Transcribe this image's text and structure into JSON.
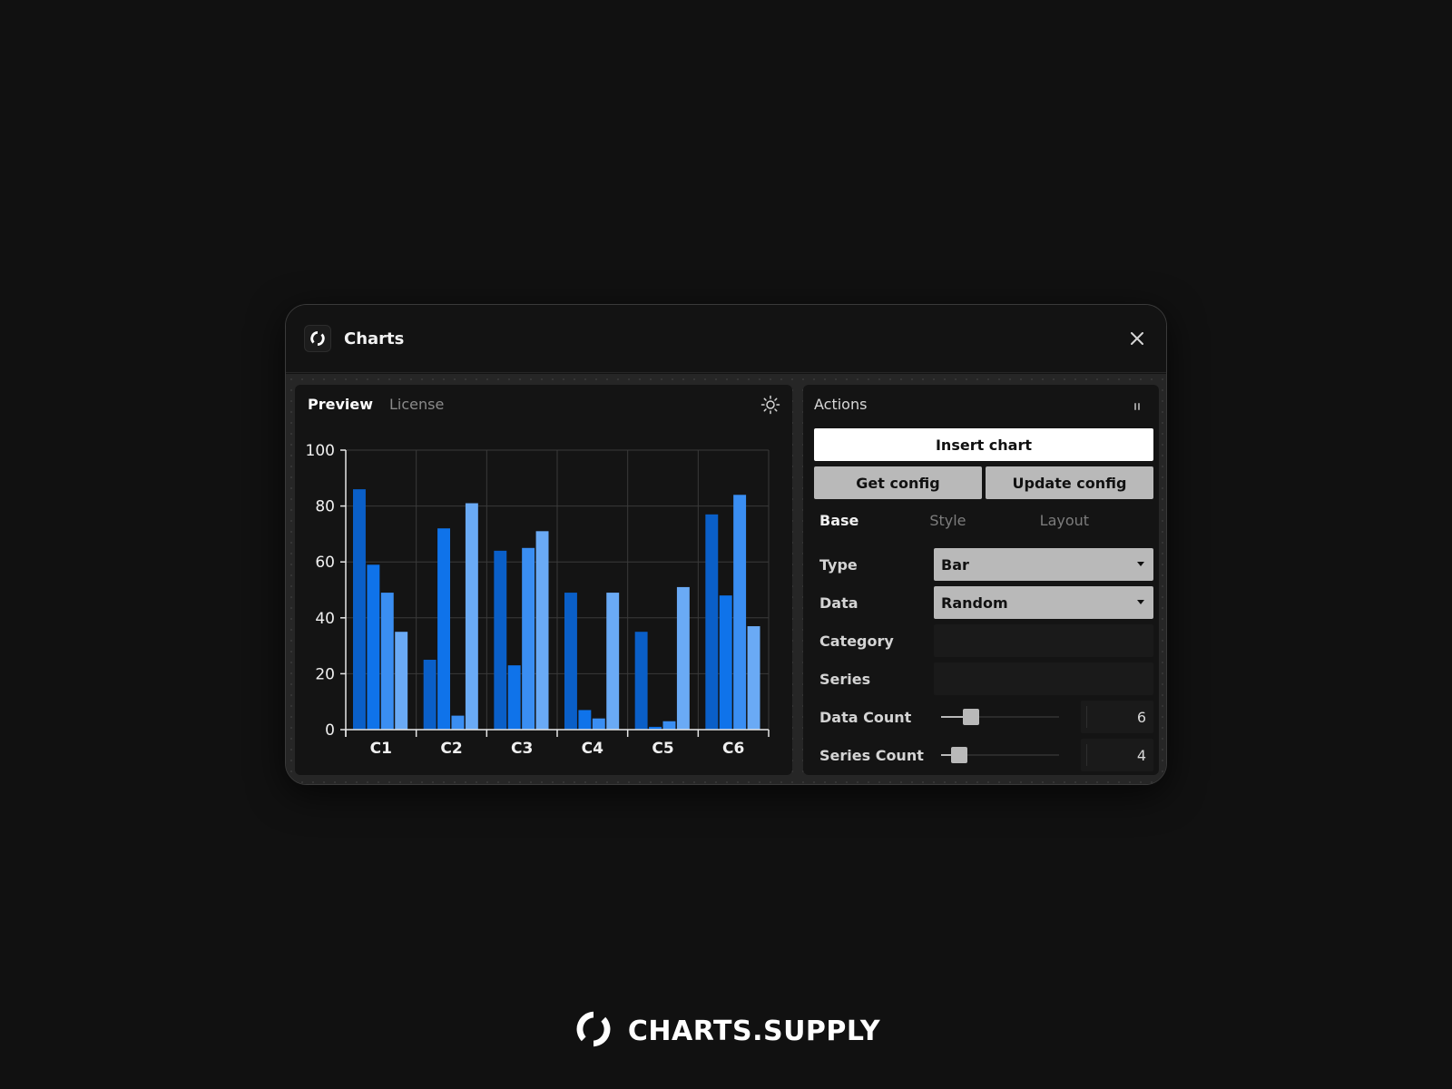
{
  "window": {
    "title": "Charts",
    "app_icon": "charts-supply-logo",
    "close_icon": "close-icon"
  },
  "preview": {
    "tabs": [
      {
        "label": "Preview",
        "active": true
      },
      {
        "label": "License",
        "active": false
      }
    ],
    "theme_icon": "sun-icon"
  },
  "actions": {
    "header": "Actions",
    "header_icon": "pause-icon",
    "insert_label": "Insert chart",
    "get_config_label": "Get config",
    "update_config_label": "Update config",
    "subtabs": [
      {
        "label": "Base",
        "active": true
      },
      {
        "label": "Style",
        "active": false
      },
      {
        "label": "Layout",
        "active": false
      }
    ],
    "type": {
      "label": "Type",
      "value": "Bar"
    },
    "data": {
      "label": "Data",
      "value": "Random"
    },
    "category": {
      "label": "Category",
      "value": ""
    },
    "series": {
      "label": "Series",
      "value": ""
    },
    "data_count": {
      "label": "Data Count",
      "value": "6",
      "slider_fraction": 0.25
    },
    "series_count": {
      "label": "Series Count",
      "value": "4",
      "slider_fraction": 0.15
    }
  },
  "colors": {
    "background": "#111111",
    "series": [
      "#0a5fc8",
      "#0f73ea",
      "#3a8ef2",
      "#6aaaf5"
    ]
  },
  "brand": {
    "text": "CHARTS.SUPPLY",
    "logo_icon": "charts-supply-logo"
  },
  "chart_data": {
    "type": "bar",
    "categories": [
      "C1",
      "C2",
      "C3",
      "C4",
      "C5",
      "C6"
    ],
    "series": [
      {
        "values": [
          86,
          25,
          64,
          49,
          35,
          77
        ]
      },
      {
        "values": [
          59,
          72,
          23,
          7,
          1,
          48
        ]
      },
      {
        "values": [
          49,
          5,
          65,
          4,
          3,
          84
        ]
      },
      {
        "values": [
          35,
          81,
          71,
          49,
          51,
          37
        ]
      }
    ],
    "ylim": [
      0,
      100
    ],
    "yticks": [
      0,
      20,
      40,
      60,
      80,
      100
    ],
    "grid": true,
    "title": "",
    "xlabel": "",
    "ylabel": ""
  }
}
